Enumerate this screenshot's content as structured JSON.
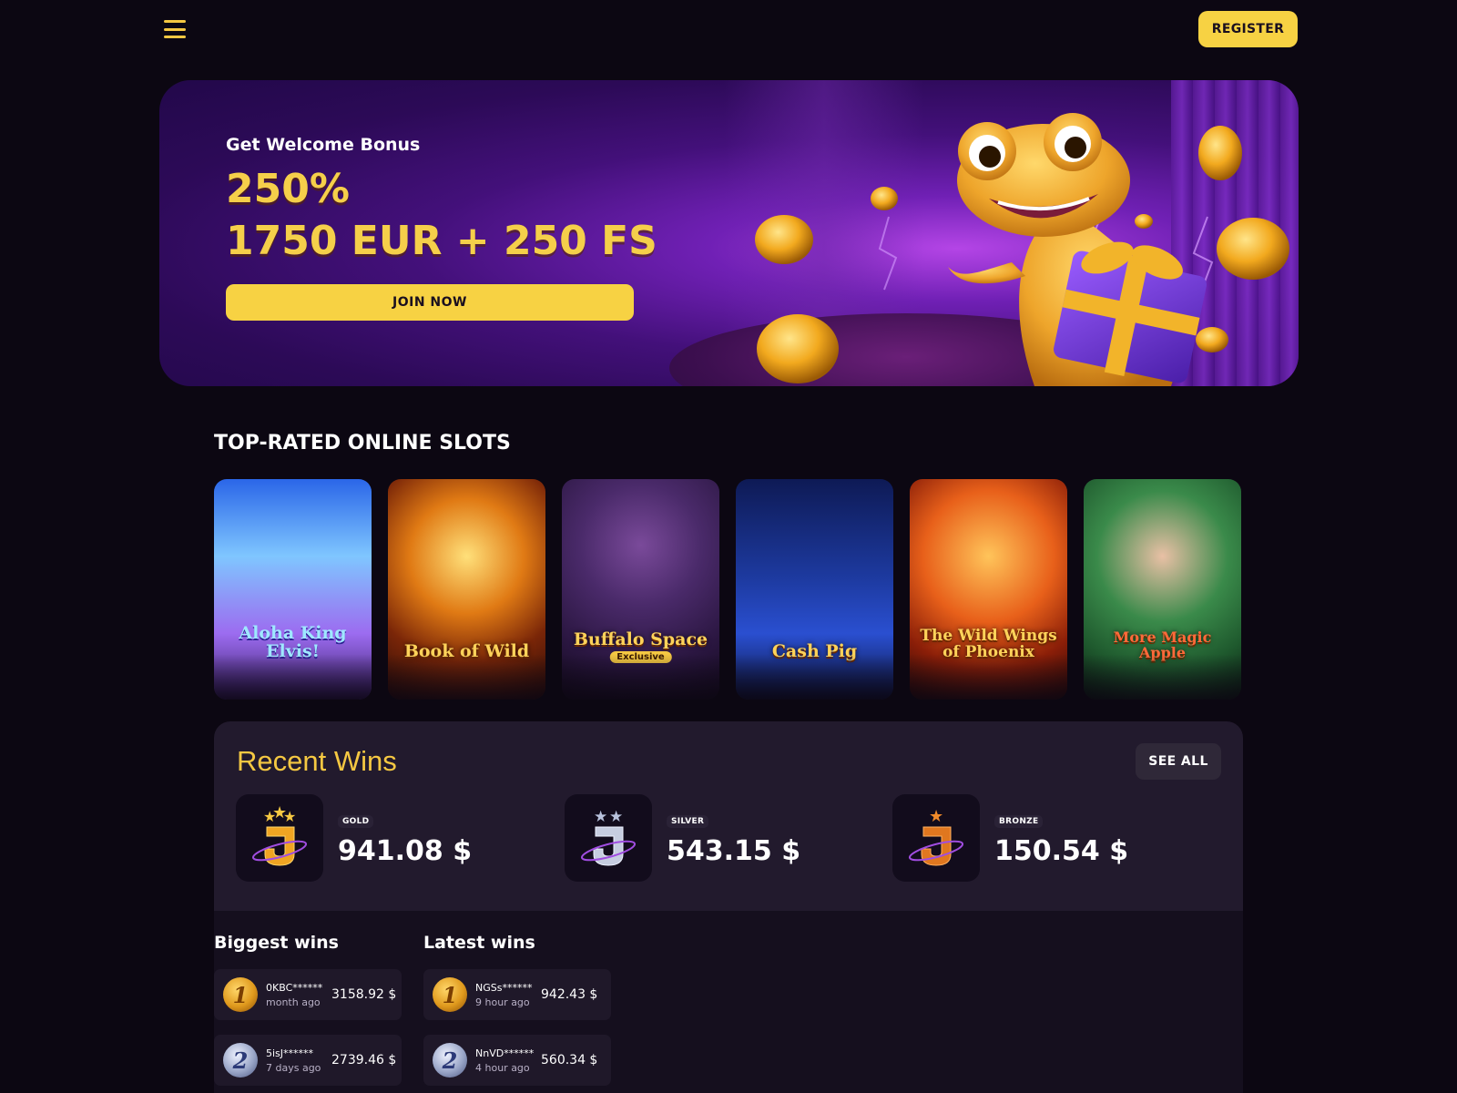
{
  "header": {
    "menu_icon": "hamburger-menu-icon",
    "register_label": "REGISTER"
  },
  "hero": {
    "subtitle": "Get Welcome Bonus",
    "percent": "250%",
    "amount": "1750 EUR + 250 FS",
    "join_label": "JOIN NOW"
  },
  "slots": {
    "title": "TOP-RATED ONLINE SLOTS",
    "items": [
      {
        "name": "Aloha King Elvis!",
        "tag": ""
      },
      {
        "name": "Book of Wild",
        "tag": ""
      },
      {
        "name": "Buffalo Space",
        "tag": "Exclusive"
      },
      {
        "name": "Cash Pig",
        "tag": ""
      },
      {
        "name": "The Wild Wings of Phoenix",
        "tag": ""
      },
      {
        "name": "More Magic Apple",
        "tag": ""
      }
    ]
  },
  "recent_wins": {
    "title": "Recent Wins",
    "see_all_label": "SEE ALL",
    "tiers": [
      {
        "label": "GOLD",
        "amount": "941.08 $",
        "stars": 3
      },
      {
        "label": "SILVER",
        "amount": "543.15 $",
        "stars": 2
      },
      {
        "label": "BRONZE",
        "amount": "150.54 $",
        "stars": 1
      }
    ]
  },
  "biggest_wins": {
    "title": "Biggest wins",
    "rows": [
      {
        "rank": "1",
        "user": "0KBC******",
        "time": "month ago",
        "amount": "3158.92 $"
      },
      {
        "rank": "2",
        "user": "5isJ******",
        "time": "7 days ago",
        "amount": "2739.46 $"
      }
    ]
  },
  "latest_wins": {
    "title": "Latest wins",
    "rows": [
      {
        "rank": "1",
        "user": "NGSs******",
        "time": "9 hour ago",
        "amount": "942.43 $"
      },
      {
        "rank": "2",
        "user": "NnVD******",
        "time": "4 hour ago",
        "amount": "560.34 $"
      }
    ]
  },
  "colors": {
    "background": "#0c0712",
    "accent_yellow": "#f7d243",
    "panel": "#221a2d",
    "hero_purple": "#43107a"
  }
}
